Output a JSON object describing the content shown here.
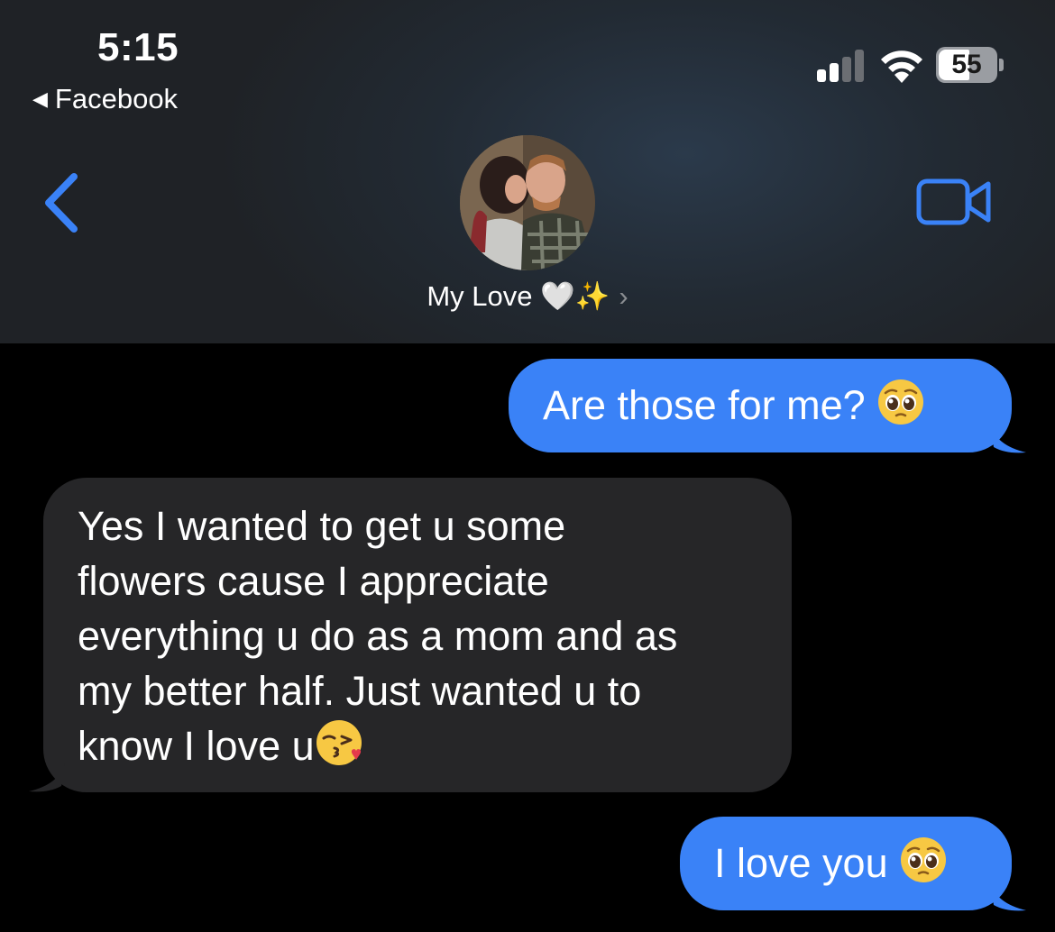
{
  "status_bar": {
    "time": "5:15",
    "back_app_label": "Facebook",
    "battery_percent": "55",
    "signal_bars": 4,
    "signal_bars_active": 2
  },
  "nav": {
    "contact_name": "My Love 🤍✨",
    "contact_chevron": "›",
    "back_icon": "chevron-left-icon",
    "video_icon": "video-camera-icon"
  },
  "colors": {
    "accent": "#3a82f7",
    "sent_bubble": "#3a82f7",
    "received_bubble": "#262628",
    "background": "#000000"
  },
  "messages": [
    {
      "direction": "sent",
      "text": "Are those for me?",
      "emoji": "pleading-face"
    },
    {
      "direction": "received",
      "lines": [
        "Yes I wanted to get u some",
        "flowers cause I appreciate",
        "everything u do as a mom and as",
        "my better half. Just wanted u to",
        "know I love u"
      ],
      "emoji": "kissing-heart-face"
    },
    {
      "direction": "sent",
      "text": "I love you",
      "emoji": "pleading-face"
    }
  ]
}
